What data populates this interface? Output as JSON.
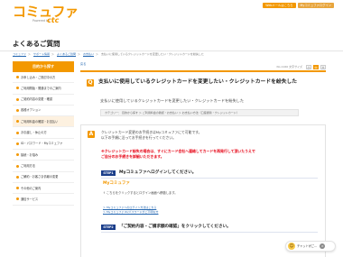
{
  "brand": {
    "name": "コミュファ",
    "sub": "Powered by",
    "ctc": "ctc"
  },
  "header": {
    "links": [
      "Webメールはこちら",
      "Myコミュファログイン"
    ]
  },
  "page": {
    "title": "よくあるご質問"
  },
  "breadcrumb": [
    "コミュファ",
    "サポート情報",
    "よくあるご質問",
    "お支払い",
    "支払いに使用しているクレジットカードを変更したい・クレジットカードを紛失した"
  ],
  "sidebar": {
    "heading": "目的から探す",
    "items": [
      "お申し込み・ご検討中の方",
      "ご利用開始・開通までのご案内",
      "ご契約内容の変更・確認",
      "各種オプション",
      "ご利用料金の確認・お支払い",
      "お引越し・休止の方",
      "ID・パスワード・Myコミュファ",
      "接続・お悩み",
      "ご利用方法",
      "ご解約・お客さま情報の変更",
      "その他のご案内",
      "通信サービス"
    ]
  },
  "main": {
    "back": "戻る",
    "meta": "No.1160  文字サイズ",
    "font_buttons": [
      "小",
      "中",
      "大"
    ],
    "question": {
      "badge": "Q",
      "title": "支払いに使用しているクレジットカードを変更したい・クレジットカードを紛失した"
    },
    "question_line": "支払いに使用しているクレジットカードを変更したい・クレジットカードを紛失した",
    "category": "カテゴリー： 目的から探す ＞ ご利用料金の確認・お支払い ＞ お支払い方法（口座振替・クレジットカード）",
    "answer": {
      "badge": "A",
      "lines": [
        "クレジットカード変更のお手続きはMyコミュファにて可能です。",
        "以下の手順に沿ってお手続きを行ってください。"
      ],
      "warn": [
        "※クレジットカード紛失の場合は、すぐにカード会社へ連絡してカードを再発行して頂いたうえで",
        "ご自分のお手続きを詳細いただきます。"
      ],
      "step1": {
        "badge": "STEP1",
        "title": "Myコミュファへログインしてください。",
        "logo": "Myコミュファ",
        "note": "↑ こちらをクリックするとログイン画面へ移動します。",
        "links": [
          "＞ Myコミュファヘのログイン方法はこちら",
          "＞ Myコミュファ ID/パスワードがご不明な方"
        ]
      },
      "step2": {
        "badge": "STEP2",
        "title": "「ご契約内容・ご請求額の確認」をクリックしてください。"
      }
    }
  },
  "chat": {
    "label": "チャットがご…",
    "close": "×",
    "face": "☺"
  }
}
